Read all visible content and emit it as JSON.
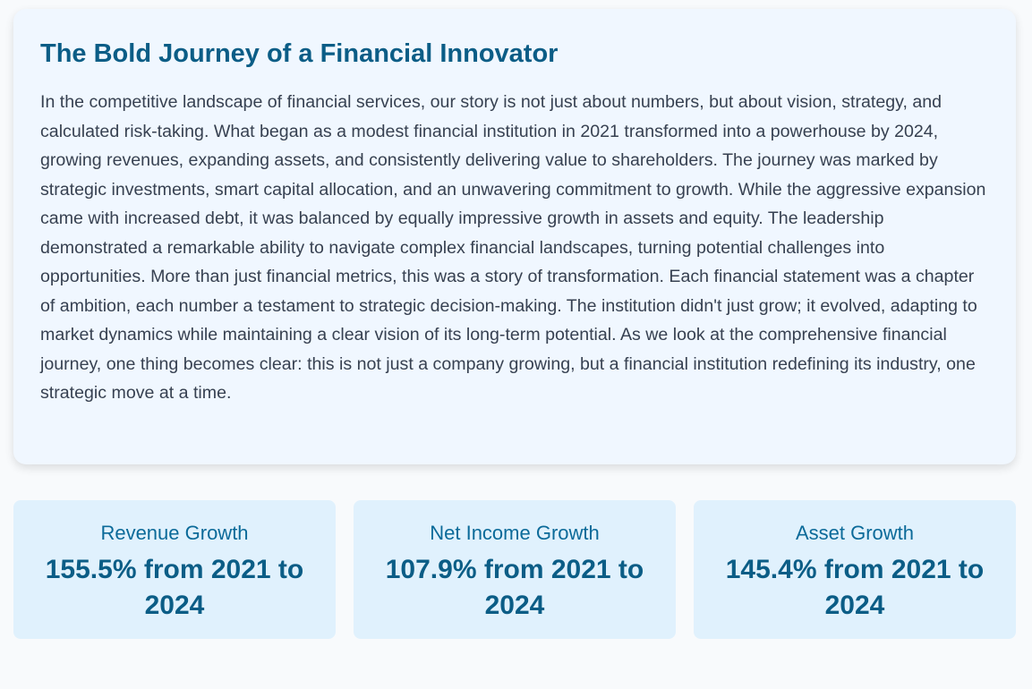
{
  "story": {
    "title": "The Bold Journey of a Financial Innovator",
    "body": "In the competitive landscape of financial services, our story is not just about numbers, but about vision, strategy, and calculated risk-taking. What began as a modest financial institution in 2021 transformed into a powerhouse by 2024, growing revenues, expanding assets, and consistently delivering value to shareholders. The journey was marked by strategic investments, smart capital allocation, and an unwavering commitment to growth. While the aggressive expansion came with increased debt, it was balanced by equally impressive growth in assets and equity. The leadership demonstrated a remarkable ability to navigate complex financial landscapes, turning potential challenges into opportunities. More than just financial metrics, this was a story of transformation. Each financial statement was a chapter of ambition, each number a testament to strategic decision-making. The institution didn't just grow; it evolved, adapting to market dynamics while maintaining a clear vision of its long-term potential. As we look at the comprehensive financial journey, one thing becomes clear: this is not just a company growing, but a financial institution redefining its industry, one strategic move at a time."
  },
  "stats": [
    {
      "label": "Revenue Growth",
      "value": "155.5% from 2021 to 2024"
    },
    {
      "label": "Net Income Growth",
      "value": "107.9% from 2021 to 2024"
    },
    {
      "label": "Asset Growth",
      "value": "145.4% from 2021 to 2024"
    }
  ],
  "colors": {
    "title": "#0b5d86",
    "card_background": "#f0f7ff",
    "stat_background": "#e0f1fd",
    "body_text": "#374151"
  }
}
